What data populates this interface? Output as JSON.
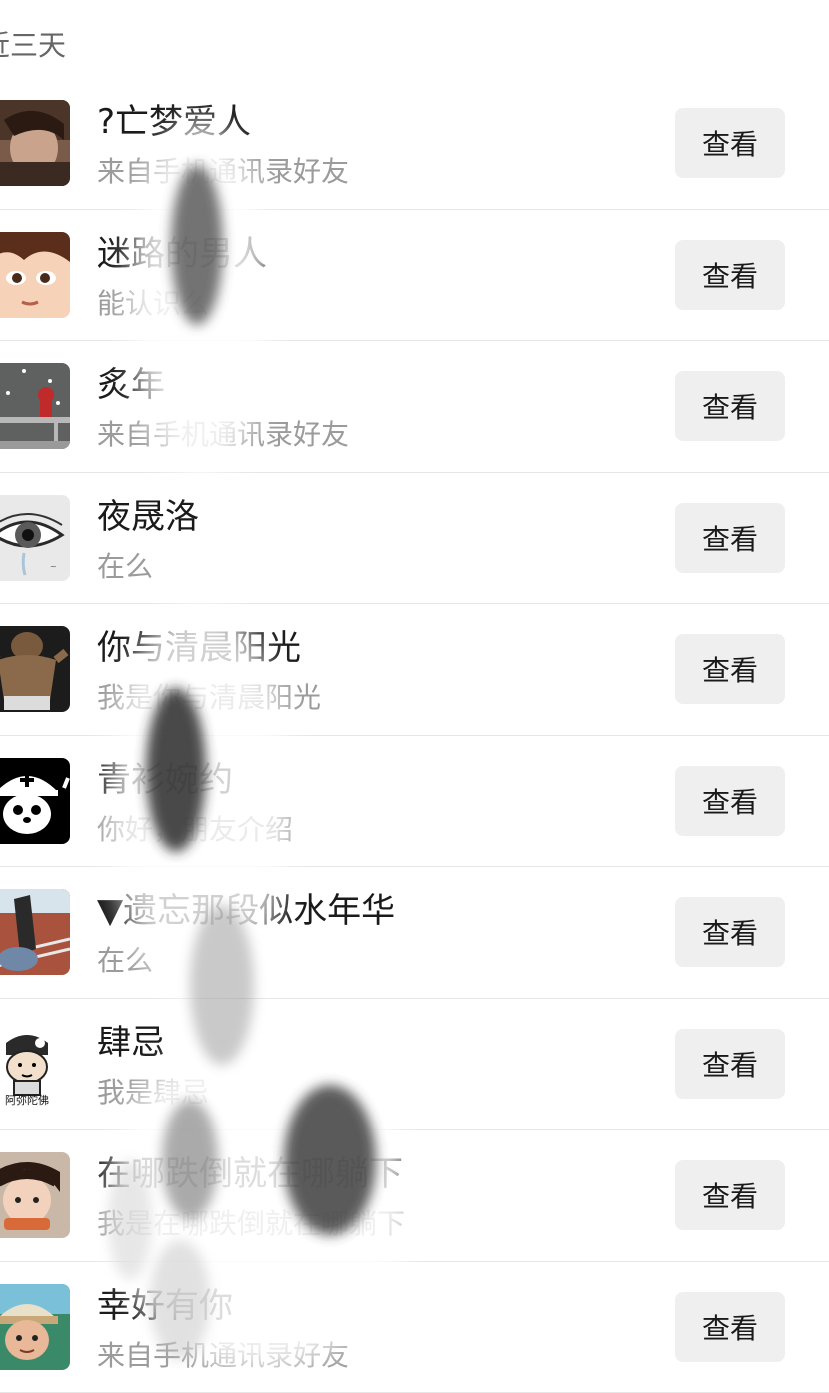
{
  "section": {
    "title": "近三天"
  },
  "button_label": "查看",
  "rows": [
    {
      "name": "?亡梦爱人",
      "subtitle": "来自手机通讯录好友",
      "avatar": "avatar-photo-person"
    },
    {
      "name": "迷路的男人",
      "subtitle": "能认识么",
      "avatar": "avatar-anime-face"
    },
    {
      "name": "炙年",
      "subtitle": "来自手机通讯录好友",
      "avatar": "avatar-snow-bench"
    },
    {
      "name": "夜晟洛",
      "subtitle": "在么",
      "avatar": "avatar-eye-sketch"
    },
    {
      "name": "你与清晨阳光",
      "subtitle": "我是你与清晨阳光",
      "avatar": "avatar-baby-back"
    },
    {
      "name": "青衫婉约",
      "subtitle": "你好，朋友介绍",
      "avatar": "avatar-chopper"
    },
    {
      "name": "▼遗忘那段似水年华",
      "subtitle": "在么",
      "avatar": "avatar-track-photo"
    },
    {
      "name": "肆忌",
      "subtitle": "我是肆忌",
      "avatar": "avatar-cartoon-monk",
      "avatar_text": "阿弥陀佛"
    },
    {
      "name": "在哪跌倒就在哪躺下",
      "subtitle": "我是在哪跌倒就在哪躺下",
      "avatar": "avatar-child-photo"
    },
    {
      "name": "幸好有你",
      "subtitle": "来自手机通讯录好友",
      "avatar": "avatar-man-cap"
    }
  ]
}
